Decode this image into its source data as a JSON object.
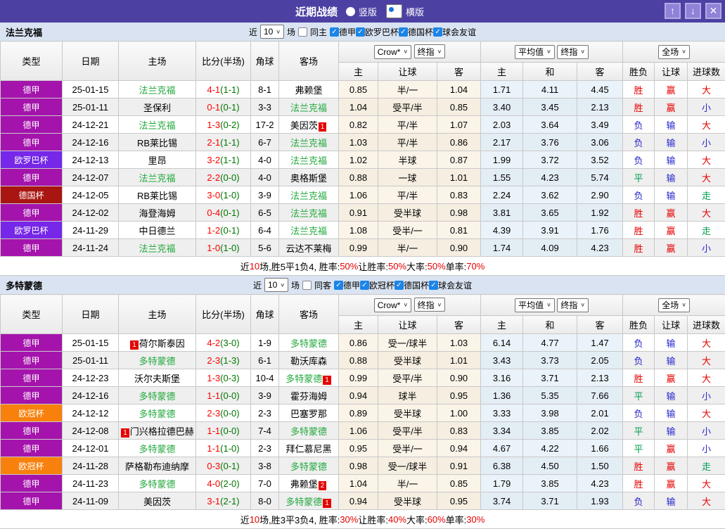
{
  "title_bar": {
    "title": "近期战绩",
    "radios": [
      {
        "label": "竖版",
        "selected": false
      },
      {
        "label": "横版",
        "selected": true
      }
    ],
    "icons": {
      "up": "↑",
      "down": "↓",
      "close": "✕"
    }
  },
  "labels": {
    "near": "近",
    "games": "场"
  },
  "selects": {
    "book": "Crow*",
    "final1": "终指",
    "avg": "平均值",
    "final2": "终指",
    "scope": "全场"
  },
  "th": {
    "type": "类型",
    "date": "日期",
    "home": "主场",
    "score": "比分(半场)",
    "corner": "角球",
    "away": "客场",
    "h": "主",
    "handicap": "让球",
    "a": "客",
    "draw": "和",
    "wl": "胜负",
    "goals": "进球数"
  },
  "colors": {
    "league": {
      "德甲": "#a414ac",
      "欧罗巴杯": "#7627e8",
      "德国杯": "#a91511",
      "欧冠杯": "#f8800d"
    },
    "result_class": {
      "胜": "r",
      "平": "g",
      "负": "b",
      "赢": "r",
      "输": "b",
      "走": "g",
      "大": "r",
      "小": "b"
    },
    "accent_red": "#e60000",
    "accent_blue": "#2626cc",
    "accent_green": "#00a050",
    "team_green": "#22a83c"
  },
  "sections": [
    {
      "team": "法兰克福",
      "filter": {
        "count": "10",
        "same": "同主",
        "leagues": [
          "德甲",
          "欧罗巴杯",
          "德国杯",
          "球会友谊"
        ]
      },
      "rows": [
        {
          "lg": "德甲",
          "date": "25-01-15",
          "home": {
            "n": "法兰克福",
            "g": true
          },
          "ft": "4-1",
          "ht": "(1-1)",
          "cn": "8-1",
          "away": {
            "n": "弗赖堡"
          },
          "o": [
            "0.85",
            "半/一",
            "1.04"
          ],
          "a": [
            "1.71",
            "4.11",
            "4.45"
          ],
          "res": [
            "胜",
            "赢",
            "大"
          ]
        },
        {
          "lg": "德甲",
          "date": "25-01-11",
          "home": {
            "n": "圣保利"
          },
          "ft": "0-1",
          "ht": "(0-1)",
          "cn": "3-3",
          "away": {
            "n": "法兰克福",
            "g": true
          },
          "o": [
            "1.04",
            "受平/半",
            "0.85"
          ],
          "a": [
            "3.40",
            "3.45",
            "2.13"
          ],
          "res": [
            "胜",
            "赢",
            "小"
          ]
        },
        {
          "lg": "德甲",
          "date": "24-12-21",
          "home": {
            "n": "法兰克福",
            "g": true
          },
          "ft": "1-3",
          "ht": "(0-2)",
          "cn": "17-2",
          "away": {
            "n": "美因茨",
            "b": "1",
            "bp": "after"
          },
          "o": [
            "0.82",
            "平/半",
            "1.07"
          ],
          "a": [
            "2.03",
            "3.64",
            "3.49"
          ],
          "res": [
            "负",
            "输",
            "大"
          ]
        },
        {
          "lg": "德甲",
          "date": "24-12-16",
          "home": {
            "n": "RB莱比锡"
          },
          "ft": "2-1",
          "ht": "(1-1)",
          "cn": "6-7",
          "away": {
            "n": "法兰克福",
            "g": true
          },
          "o": [
            "1.03",
            "平/半",
            "0.86"
          ],
          "a": [
            "2.17",
            "3.76",
            "3.06"
          ],
          "res": [
            "负",
            "输",
            "小"
          ]
        },
        {
          "lg": "欧罗巴杯",
          "date": "24-12-13",
          "home": {
            "n": "里昂"
          },
          "ft": "3-2",
          "ht": "(1-1)",
          "cn": "4-0",
          "away": {
            "n": "法兰克福",
            "g": true
          },
          "o": [
            "1.02",
            "半球",
            "0.87"
          ],
          "a": [
            "1.99",
            "3.72",
            "3.52"
          ],
          "res": [
            "负",
            "输",
            "大"
          ]
        },
        {
          "lg": "德甲",
          "date": "24-12-07",
          "home": {
            "n": "法兰克福",
            "g": true
          },
          "ft": "2-2",
          "ht": "(0-0)",
          "cn": "4-0",
          "away": {
            "n": "奥格斯堡"
          },
          "o": [
            "0.88",
            "一球",
            "1.01"
          ],
          "a": [
            "1.55",
            "4.23",
            "5.74"
          ],
          "res": [
            "平",
            "输",
            "大"
          ]
        },
        {
          "lg": "德国杯",
          "date": "24-12-05",
          "home": {
            "n": "RB莱比锡"
          },
          "ft": "3-0",
          "ht": "(1-0)",
          "cn": "3-9",
          "away": {
            "n": "法兰克福",
            "g": true
          },
          "o": [
            "1.06",
            "平/半",
            "0.83"
          ],
          "a": [
            "2.24",
            "3.62",
            "2.90"
          ],
          "res": [
            "负",
            "输",
            "走"
          ]
        },
        {
          "lg": "德甲",
          "date": "24-12-02",
          "home": {
            "n": "海登海姆"
          },
          "ft": "0-4",
          "ht": "(0-1)",
          "cn": "6-5",
          "away": {
            "n": "法兰克福",
            "g": true
          },
          "o": [
            "0.91",
            "受半球",
            "0.98"
          ],
          "a": [
            "3.81",
            "3.65",
            "1.92"
          ],
          "res": [
            "胜",
            "赢",
            "大"
          ]
        },
        {
          "lg": "欧罗巴杯",
          "date": "24-11-29",
          "home": {
            "n": "中日德兰"
          },
          "ft": "1-2",
          "ht": "(0-1)",
          "cn": "6-4",
          "away": {
            "n": "法兰克福",
            "g": true
          },
          "o": [
            "1.08",
            "受半/一",
            "0.81"
          ],
          "a": [
            "4.39",
            "3.91",
            "1.76"
          ],
          "res": [
            "胜",
            "赢",
            "走"
          ]
        },
        {
          "lg": "德甲",
          "date": "24-11-24",
          "home": {
            "n": "法兰克福",
            "g": true
          },
          "ft": "1-0",
          "ht": "(1-0)",
          "cn": "5-6",
          "away": {
            "n": "云达不莱梅"
          },
          "o": [
            "0.99",
            "半/一",
            "0.90"
          ],
          "a": [
            "1.74",
            "4.09",
            "4.23"
          ],
          "res": [
            "胜",
            "赢",
            "小"
          ]
        }
      ],
      "summary": [
        {
          "t": "近"
        },
        {
          "t": "10",
          "r": true
        },
        {
          "t": "场,胜5平1负4, 胜率:"
        },
        {
          "t": "50%",
          "r": true
        },
        {
          "t": " 让胜率:"
        },
        {
          "t": "50%",
          "r": true
        },
        {
          "t": " 大率:"
        },
        {
          "t": "50%",
          "r": true
        },
        {
          "t": " 单率:"
        },
        {
          "t": "70%",
          "r": true
        }
      ]
    },
    {
      "team": "多特蒙德",
      "filter": {
        "count": "10",
        "same": "同客",
        "leagues": [
          "德甲",
          "欧冠杯",
          "德国杯",
          "球会友谊"
        ]
      },
      "rows": [
        {
          "lg": "德甲",
          "date": "25-01-15",
          "home": {
            "n": "荷尔斯泰因",
            "b": "1",
            "bp": "before"
          },
          "ft": "4-2",
          "ht": "(3-0)",
          "cn": "1-9",
          "away": {
            "n": "多特蒙德",
            "g": true
          },
          "o": [
            "0.86",
            "受一/球半",
            "1.03"
          ],
          "a": [
            "6.14",
            "4.77",
            "1.47"
          ],
          "res": [
            "负",
            "输",
            "大"
          ]
        },
        {
          "lg": "德甲",
          "date": "25-01-11",
          "home": {
            "n": "多特蒙德",
            "g": true
          },
          "ft": "2-3",
          "ht": "(1-3)",
          "cn": "6-1",
          "away": {
            "n": "勒沃库森"
          },
          "o": [
            "0.88",
            "受半球",
            "1.01"
          ],
          "a": [
            "3.43",
            "3.73",
            "2.05"
          ],
          "res": [
            "负",
            "输",
            "大"
          ]
        },
        {
          "lg": "德甲",
          "date": "24-12-23",
          "home": {
            "n": "沃尔夫斯堡"
          },
          "ft": "1-3",
          "ht": "(0-3)",
          "cn": "10-4",
          "away": {
            "n": "多特蒙德",
            "g": true,
            "b": "1",
            "bp": "after"
          },
          "o": [
            "0.99",
            "受平/半",
            "0.90"
          ],
          "a": [
            "3.16",
            "3.71",
            "2.13"
          ],
          "res": [
            "胜",
            "赢",
            "大"
          ]
        },
        {
          "lg": "德甲",
          "date": "24-12-16",
          "home": {
            "n": "多特蒙德",
            "g": true
          },
          "ft": "1-1",
          "ht": "(0-0)",
          "cn": "3-9",
          "away": {
            "n": "霍芬海姆"
          },
          "o": [
            "0.94",
            "球半",
            "0.95"
          ],
          "a": [
            "1.36",
            "5.35",
            "7.66"
          ],
          "res": [
            "平",
            "输",
            "小"
          ]
        },
        {
          "lg": "欧冠杯",
          "date": "24-12-12",
          "home": {
            "n": "多特蒙德",
            "g": true
          },
          "ft": "2-3",
          "ht": "(0-0)",
          "cn": "2-3",
          "away": {
            "n": "巴塞罗那"
          },
          "o": [
            "0.89",
            "受半球",
            "1.00"
          ],
          "a": [
            "3.33",
            "3.98",
            "2.01"
          ],
          "res": [
            "负",
            "输",
            "大"
          ]
        },
        {
          "lg": "德甲",
          "date": "24-12-08",
          "home": {
            "n": "门兴格拉德巴赫",
            "b": "1",
            "bp": "before"
          },
          "ft": "1-1",
          "ht": "(0-0)",
          "cn": "7-4",
          "away": {
            "n": "多特蒙德",
            "g": true
          },
          "o": [
            "1.06",
            "受平/半",
            "0.83"
          ],
          "a": [
            "3.34",
            "3.85",
            "2.02"
          ],
          "res": [
            "平",
            "输",
            "小"
          ]
        },
        {
          "lg": "德甲",
          "date": "24-12-01",
          "home": {
            "n": "多特蒙德",
            "g": true
          },
          "ft": "1-1",
          "ht": "(1-0)",
          "cn": "2-3",
          "away": {
            "n": "拜仁慕尼黑"
          },
          "o": [
            "0.95",
            "受半/一",
            "0.94"
          ],
          "a": [
            "4.67",
            "4.22",
            "1.66"
          ],
          "res": [
            "平",
            "赢",
            "小"
          ]
        },
        {
          "lg": "欧冠杯",
          "date": "24-11-28",
          "home": {
            "n": "萨格勒布迪纳摩"
          },
          "ft": "0-3",
          "ht": "(0-1)",
          "cn": "3-8",
          "away": {
            "n": "多特蒙德",
            "g": true
          },
          "o": [
            "0.98",
            "受一/球半",
            "0.91"
          ],
          "a": [
            "6.38",
            "4.50",
            "1.50"
          ],
          "res": [
            "胜",
            "赢",
            "走"
          ]
        },
        {
          "lg": "德甲",
          "date": "24-11-23",
          "home": {
            "n": "多特蒙德",
            "g": true
          },
          "ft": "4-0",
          "ht": "(2-0)",
          "cn": "7-0",
          "away": {
            "n": "弗赖堡",
            "b": "2",
            "bp": "after"
          },
          "o": [
            "1.04",
            "半/一",
            "0.85"
          ],
          "a": [
            "1.79",
            "3.85",
            "4.23"
          ],
          "res": [
            "胜",
            "赢",
            "大"
          ]
        },
        {
          "lg": "德甲",
          "date": "24-11-09",
          "home": {
            "n": "美因茨"
          },
          "ft": "3-1",
          "ht": "(2-1)",
          "cn": "8-0",
          "away": {
            "n": "多特蒙德",
            "g": true,
            "b": "1",
            "bp": "after"
          },
          "o": [
            "0.94",
            "受半球",
            "0.95"
          ],
          "a": [
            "3.74",
            "3.71",
            "1.93"
          ],
          "res": [
            "负",
            "输",
            "大"
          ]
        }
      ],
      "summary": [
        {
          "t": "近"
        },
        {
          "t": "10",
          "r": true
        },
        {
          "t": "场,胜3平3负4, 胜率:"
        },
        {
          "t": "30%",
          "r": true
        },
        {
          "t": " 让胜率:"
        },
        {
          "t": "40%",
          "r": true
        },
        {
          "t": " 大率:"
        },
        {
          "t": "60%",
          "r": true
        },
        {
          "t": " 单率:"
        },
        {
          "t": "30%",
          "r": true
        }
      ]
    }
  ]
}
